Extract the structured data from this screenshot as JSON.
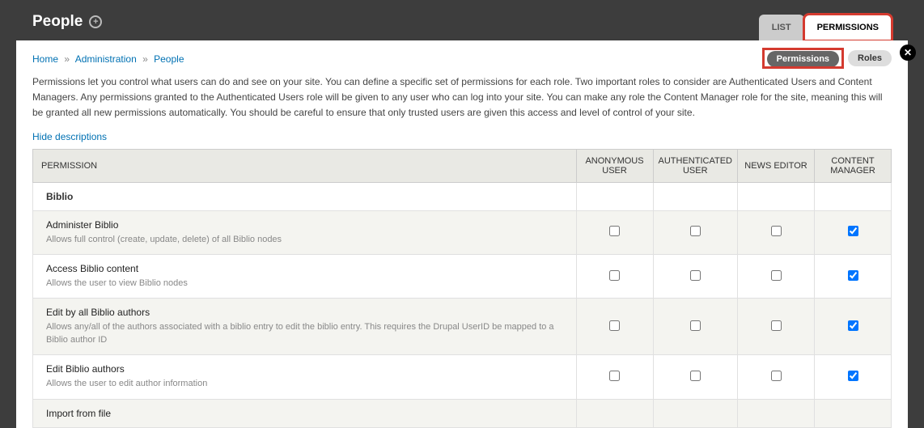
{
  "header": {
    "title": "People",
    "tabs": [
      {
        "label": "LIST",
        "active": false
      },
      {
        "label": "PERMISSIONS",
        "active": true,
        "highlight": true
      }
    ]
  },
  "breadcrumb": {
    "items": [
      "Home",
      "Administration",
      "People"
    ]
  },
  "subtabs": [
    {
      "label": "Permissions",
      "active": true,
      "highlight": true
    },
    {
      "label": "Roles",
      "active": false
    }
  ],
  "intro": "Permissions let you control what users can do and see on your site. You can define a specific set of permissions for each role. Two important roles to consider are Authenticated Users and Content Managers. Any permissions granted to the Authenticated Users role will be given to any user who can log into your site. You can make any role the Content Manager role for the site, meaning this will be granted all new permissions automatically. You should be careful to ensure that only trusted users are given this access and level of control of your site.",
  "hide_descriptions": "Hide descriptions",
  "table": {
    "columns": {
      "permission": "PERMISSION",
      "roles": [
        "ANONYMOUS USER",
        "AUTHENTICATED USER",
        "NEWS EDITOR",
        "CONTENT MANAGER"
      ]
    },
    "highlight_role_index": 2,
    "groups": [
      {
        "name": "Biblio",
        "rows": [
          {
            "title": "Administer Biblio",
            "desc": "Allows full control (create, update, delete) of all Biblio nodes",
            "checks": [
              false,
              false,
              false,
              true
            ]
          },
          {
            "title": "Access Biblio content",
            "desc": "Allows the user to view Biblio nodes",
            "checks": [
              false,
              false,
              false,
              true
            ]
          },
          {
            "title": "Edit by all Biblio authors",
            "desc": "Allows any/all of the authors associated with a biblio entry to edit the biblio entry. This requires the Drupal UserID be mapped to a Biblio author ID",
            "checks": [
              false,
              false,
              false,
              true
            ]
          },
          {
            "title": "Edit Biblio authors",
            "desc": "Allows the user to edit author information",
            "checks": [
              false,
              false,
              false,
              true
            ]
          },
          {
            "title": "Import from file",
            "desc": "",
            "checks": [
              null,
              null,
              null,
              null
            ]
          }
        ]
      }
    ]
  }
}
